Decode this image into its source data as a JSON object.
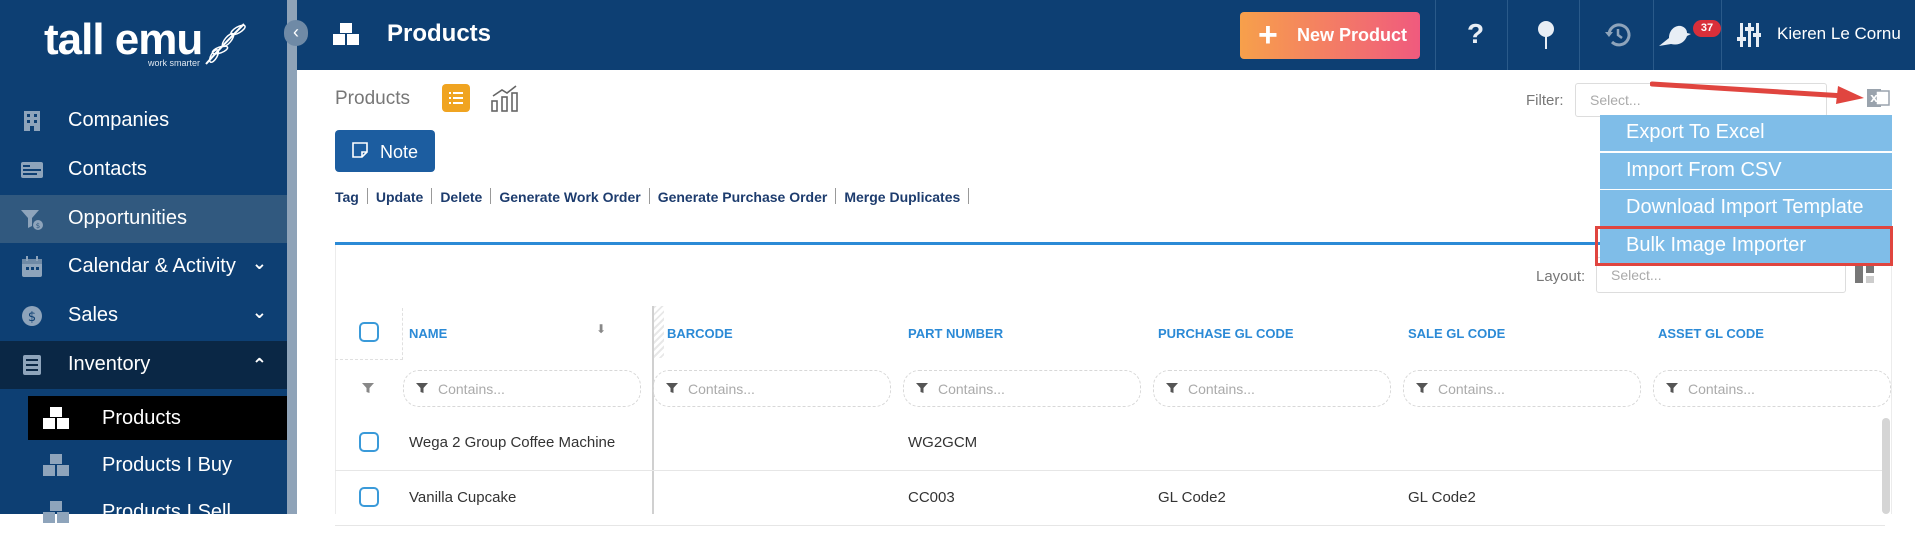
{
  "brand": {
    "name": "tall emu",
    "tagline": "work smarter"
  },
  "sidebar": {
    "items": [
      {
        "label": "Companies",
        "icon": "building-icon"
      },
      {
        "label": "Contacts",
        "icon": "contact-card-icon"
      },
      {
        "label": "Opportunities",
        "icon": "funnel-dollar-icon"
      },
      {
        "label": "Calendar & Activity",
        "icon": "calendar-icon"
      },
      {
        "label": "Sales",
        "icon": "dollar-icon"
      },
      {
        "label": "Inventory",
        "icon": "inventory-icon"
      }
    ],
    "sub_items": [
      {
        "label": "Products"
      },
      {
        "label": "Products I Buy"
      },
      {
        "label": "Products I Sell"
      }
    ]
  },
  "header": {
    "title": "Products",
    "new_button": "New Product",
    "notification_count": "37",
    "user_name": "Kieren Le Cornu"
  },
  "toolbar": {
    "breadcrumb": "Products",
    "filter_label": "Filter:",
    "filter_placeholder": "Select...",
    "note_button": "Note",
    "actions": [
      "Tag",
      "Update",
      "Delete",
      "Generate Work Order",
      "Generate Purchase Order",
      "Merge Duplicates"
    ]
  },
  "export_menu": {
    "items": [
      "Export To Excel",
      "Import From CSV",
      "Download Import Template",
      "Bulk Image Importer"
    ],
    "highlighted": "Bulk Image Importer"
  },
  "grid": {
    "layout_label": "Layout:",
    "layout_placeholder": "Select...",
    "columns": [
      "NAME",
      "BARCODE",
      "PART NUMBER",
      "PURCHASE GL CODE",
      "SALE GL CODE",
      "ASSET GL CODE"
    ],
    "filter_placeholder": "Contains...",
    "rows": [
      {
        "name": "Wega 2 Group Coffee Machine",
        "barcode": "",
        "part_number": "WG2GCM",
        "purchase_gl": "",
        "sale_gl": "",
        "asset_gl": ""
      },
      {
        "name": "Vanilla Cupcake",
        "barcode": "",
        "part_number": "CC003",
        "purchase_gl": "GL Code2",
        "sale_gl": "GL Code2",
        "asset_gl": ""
      }
    ]
  },
  "colors": {
    "sidebar": "#0d3f73",
    "accent": "#2b8ad6",
    "menu": "#7fbde8",
    "highlight": "#e0453f",
    "new_button_from": "#f7a04b",
    "new_button_to": "#f05a7e"
  }
}
